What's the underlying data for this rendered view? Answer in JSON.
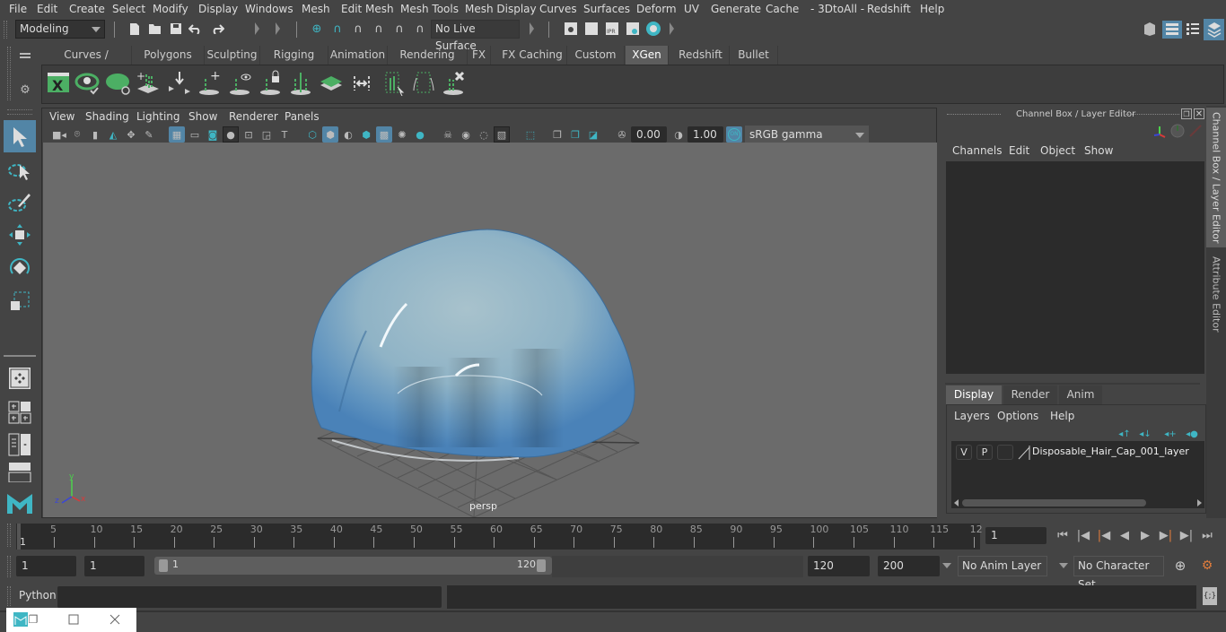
{
  "menubar": {
    "items": [
      "File",
      "Edit",
      "Create",
      "Select",
      "Modify",
      "Display",
      "Windows",
      "Mesh",
      "Edit Mesh",
      "Mesh Tools",
      "Mesh Display",
      "Curves",
      "Surfaces",
      "Deform",
      "UV",
      "Generate",
      "Cache",
      "- 3DtoAll -",
      "Redshift",
      "Help"
    ]
  },
  "statusline": {
    "mode_menu": "Modeling",
    "live_surface": "No Live Surface"
  },
  "shelf": {
    "tabs": [
      "Curves / Surfaces",
      "Polygons",
      "Sculpting",
      "Rigging",
      "Animation",
      "Rendering",
      "FX",
      "FX Caching",
      "Custom",
      "XGen",
      "Redshift",
      "Bullet"
    ],
    "active_tab": "XGen"
  },
  "viewport": {
    "menu": [
      "View",
      "Shading",
      "Lighting",
      "Show",
      "Renderer",
      "Panels"
    ],
    "exposure": "0.00",
    "gamma": "1.00",
    "color_mgmt_toggle": "ON",
    "color_space": "sRGB gamma",
    "camera_label": "persp",
    "axis_labels": {
      "x": "x",
      "y": "y",
      "z": "z"
    }
  },
  "channel_box": {
    "title": "Channel Box / Layer Editor",
    "menu": [
      "Channels",
      "Edit",
      "Object",
      "Show"
    ]
  },
  "layer_editor": {
    "tabs": [
      "Display",
      "Render",
      "Anim"
    ],
    "active_tab": "Display",
    "menu": [
      "Layers",
      "Options",
      "Help"
    ],
    "layers": [
      {
        "visible": "V",
        "playback": "P",
        "name": "Disposable_Hair_Cap_001_layer"
      }
    ]
  },
  "side_tabs": [
    "Channel Box / Layer Editor",
    "Attribute Editor"
  ],
  "timeline": {
    "ticks": [
      "5",
      "10",
      "15",
      "20",
      "25",
      "30",
      "35",
      "40",
      "45",
      "50",
      "55",
      "60",
      "65",
      "70",
      "75",
      "80",
      "85",
      "90",
      "95",
      "100",
      "105",
      "110",
      "115",
      "12"
    ],
    "current_marker": "1",
    "current_frame": "1"
  },
  "range": {
    "start_time": "1",
    "playback_start": "1",
    "slider_min": "1",
    "slider_max": "120",
    "playback_end": "120",
    "end_time": "200",
    "anim_layer": "No Anim Layer",
    "character_set": "No Character Set"
  },
  "command_line": {
    "language": "Python",
    "input": "",
    "result": ""
  },
  "colors": {
    "accent_blue": "#5285a6",
    "xgen_green": "#4caf64",
    "teal": "#3fb6c4",
    "key_orange": "#e07c3c"
  }
}
